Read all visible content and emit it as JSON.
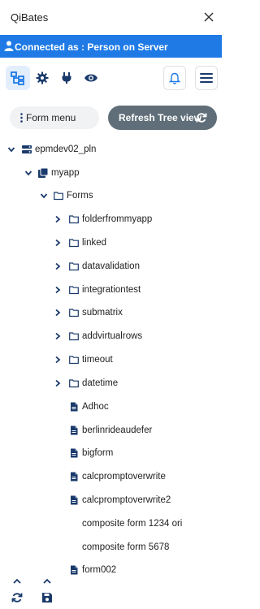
{
  "app": {
    "title": "QiBates"
  },
  "connection": {
    "text": "Connected as : Person on Server",
    "color": "#1f7ae6"
  },
  "toolbar": {
    "icons": [
      "tree-view-icon",
      "gear-icon",
      "plug-icon",
      "eye-icon",
      "bell-icon",
      "hamburger-icon"
    ],
    "accent": "#1f7ae6"
  },
  "actions": {
    "form_menu_label": "Form menu",
    "refresh_label": "Refresh Tree view"
  },
  "tree": {
    "server": "epmdev02_pln",
    "app": "myapp",
    "forms_folder": "Forms",
    "folders": [
      "folderfrommyapp",
      "linked",
      "datavalidation",
      "integrationtest",
      "submatrix",
      "addvirtualrows",
      "timeout",
      "datetime"
    ],
    "forms": [
      "Adhoc",
      "berlinrideaudefer",
      "bigform",
      "calcpromptoverwrite",
      "calcpromptoverwrite2"
    ],
    "composites": [
      "composite form 1234 ori",
      "composite form 5678"
    ],
    "partial": "form002"
  },
  "footer": {
    "icons": [
      "chevron-up-icon",
      "chevron-up-icon",
      "refresh-icon",
      "save-icon"
    ]
  }
}
